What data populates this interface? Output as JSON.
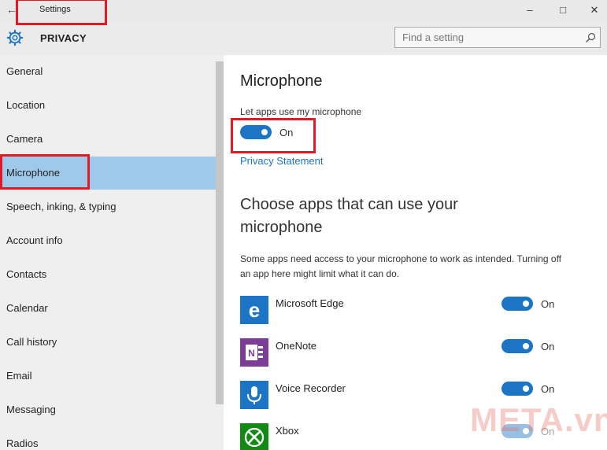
{
  "window": {
    "title": "Settings"
  },
  "header": {
    "section": "PRIVACY",
    "search_placeholder": "Find a setting"
  },
  "sidebar": {
    "items": [
      {
        "label": "General"
      },
      {
        "label": "Location"
      },
      {
        "label": "Camera"
      },
      {
        "label": "Microphone",
        "selected": true
      },
      {
        "label": "Speech, inking, & typing"
      },
      {
        "label": "Account info"
      },
      {
        "label": "Contacts"
      },
      {
        "label": "Calendar"
      },
      {
        "label": "Call history"
      },
      {
        "label": "Email"
      },
      {
        "label": "Messaging"
      },
      {
        "label": "Radios"
      }
    ]
  },
  "main": {
    "title": "Microphone",
    "allow_label": "Let apps use my microphone",
    "allow_state": "On",
    "privacy_link": "Privacy Statement",
    "choose_heading": "Choose apps that can use your microphone",
    "description": "Some apps need access to your microphone to work as intended. Turning off an app here might limit what it can do.",
    "apps": [
      {
        "name": "Microsoft Edge",
        "state": "On",
        "icon": "edge-icon",
        "color": "#1b74c4"
      },
      {
        "name": "OneNote",
        "state": "On",
        "icon": "onenote-icon",
        "color": "#7b3d96"
      },
      {
        "name": "Voice Recorder",
        "state": "On",
        "icon": "voice-recorder-icon",
        "color": "#1b74c4"
      },
      {
        "name": "Xbox",
        "state": "On",
        "icon": "xbox-icon",
        "color": "#138a13"
      }
    ]
  },
  "watermark": "META.vn",
  "colors": {
    "accent": "#1b74c4",
    "selection": "#9fc9ea",
    "highlight": "#e01b24"
  }
}
